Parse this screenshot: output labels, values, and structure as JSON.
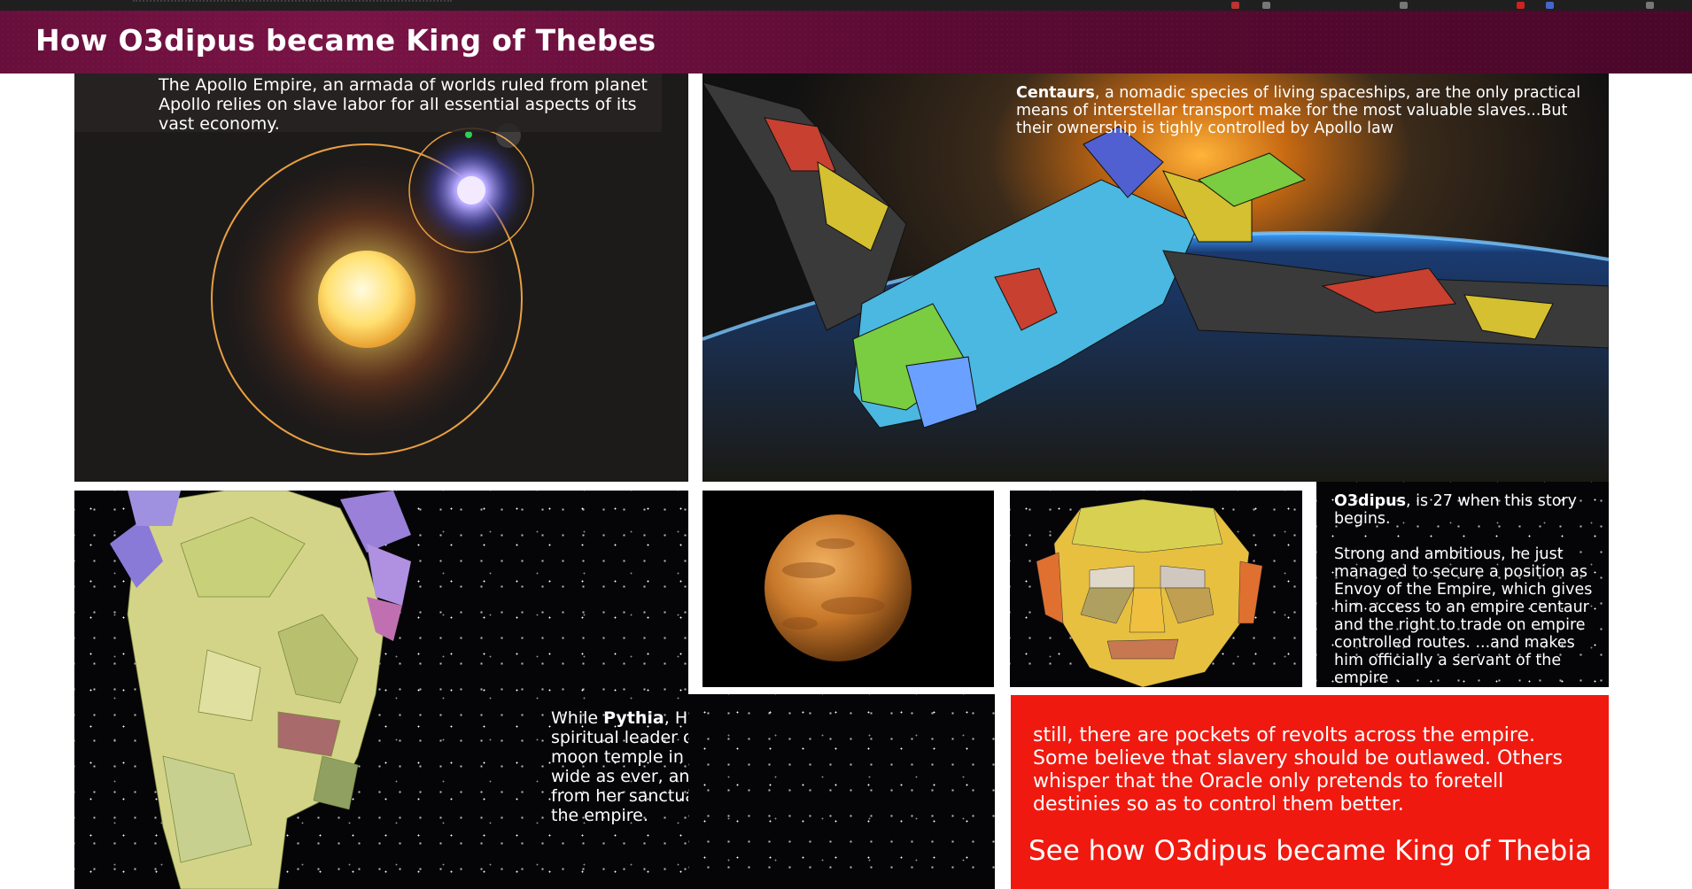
{
  "header": {
    "title": "How O3dipus became King of Thebes"
  },
  "panels": {
    "solar": {
      "caption": "The Apollo Empire, an armada of worlds ruled from planet Apollo relies on slave labor for all essential aspects of its vast economy."
    },
    "ship": {
      "highlight": "Centaurs",
      "caption": ", a nomadic species of living spaceships, are the only practical means of interstellar transport make for the most valuable slaves...But their ownership is tighly controlled by Apollo law"
    },
    "pythia": {
      "lead": "While ",
      "highlight": "Pythia",
      "caption": ", High Priestess of Apollo, and spiritual leader of the empire hasn't left her moon temple in decades, her nets spread as wide as ever, and the schemes she devises from her sanctuary influence every destiny in the empire."
    },
    "oedipus": {
      "highlight": "O3dipus",
      "line1": ", is 27 when this story begins.",
      "paragraph2": "Strong and ambitious, he just managed to secure a position as Envoy of the Empire, which gives him access to an empire centaur and the right to trade on empire controlled routes. ...and makes him officially a servant of the empire"
    },
    "revolt": {
      "caption": "still, there are pockets of revolts across the empire. Some believe that slavery should be outlawed. Others whisper that the Oracle only pretends to foretell destinies so as to control them better.",
      "cta": "See how O3dipus became King of Thebia"
    }
  },
  "colors": {
    "header": "#5a0a33",
    "revolt_panel": "#f0190f",
    "orbit": "#e8a040",
    "sun": "#ffe27a"
  }
}
